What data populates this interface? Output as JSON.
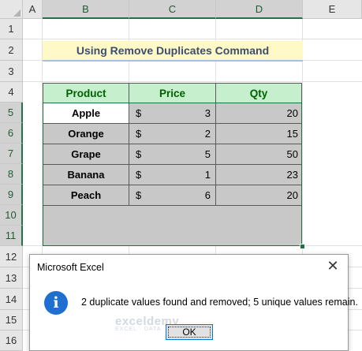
{
  "spreadsheet": {
    "columns": [
      "A",
      "B",
      "C",
      "D",
      "E"
    ],
    "rows": [
      "1",
      "2",
      "3",
      "4",
      "5",
      "6",
      "7",
      "8",
      "9",
      "10",
      "11",
      "12",
      "13",
      "14",
      "15",
      "16"
    ],
    "title": "Using Remove Duplicates Command",
    "table": {
      "headers": [
        "Product",
        "Price",
        "Qty"
      ],
      "rows": [
        {
          "product": "Apple",
          "currency": "$",
          "price": "3",
          "qty": "20"
        },
        {
          "product": "Orange",
          "currency": "$",
          "price": "2",
          "qty": "15"
        },
        {
          "product": "Grape",
          "currency": "$",
          "price": "5",
          "qty": "50"
        },
        {
          "product": "Banana",
          "currency": "$",
          "price": "1",
          "qty": "23"
        },
        {
          "product": "Peach",
          "currency": "$",
          "price": "6",
          "qty": "20"
        }
      ]
    },
    "colors": {
      "header_fill": "#c6efce",
      "header_text": "#006100",
      "selection_fill": "#c8c8c8",
      "title_fill": "#fff9c8",
      "accent": "#217346"
    }
  },
  "dialog": {
    "title": "Microsoft Excel",
    "close_icon": "close-icon",
    "icon": "info-icon",
    "icon_glyph": "i",
    "message": "2 duplicate values found and removed; 5 unique values remain.",
    "ok_label": "OK",
    "watermark": "exceldemy",
    "watermark_sub": "EXCEL · DATA · BI"
  }
}
